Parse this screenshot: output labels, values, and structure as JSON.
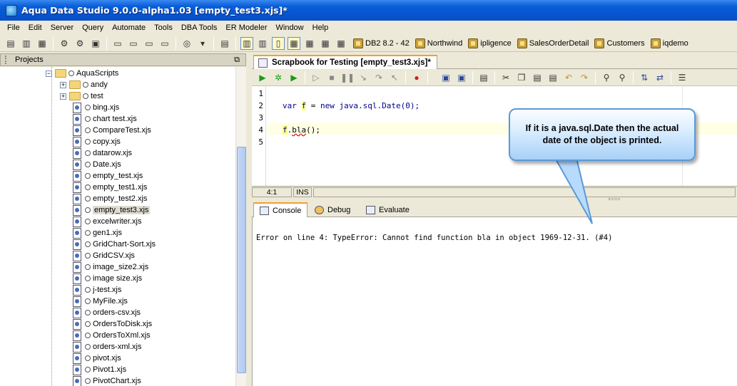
{
  "window": {
    "title": "Aqua Data Studio 9.0.0-alpha1.03 [empty_test3.xjs]*"
  },
  "menu": [
    "File",
    "Edit",
    "Server",
    "Query",
    "Automate",
    "Tools",
    "DBA Tools",
    "ER Modeler",
    "Window",
    "Help"
  ],
  "connections": [
    "DB2 8.2 - 42",
    "Northwind",
    "ipligence",
    "SalesOrderDetail",
    "Customers",
    "iqdemo"
  ],
  "projects_panel": {
    "title": "Projects",
    "restore_glyph": "⧉",
    "tree": {
      "root": "AquaScripts",
      "folders": [
        "andy",
        "test"
      ],
      "files": [
        "bing.xjs",
        "chart test.xjs",
        "CompareTest.xjs",
        "copy.xjs",
        "datarow.xjs",
        "Date.xjs",
        "empty_test.xjs",
        "empty_test1.xjs",
        "empty_test2.xjs",
        "empty_test3.xjs",
        "excelwriter.xjs",
        "gen1.xjs",
        "GridChart-Sort.xjs",
        "GridCSV.xjs",
        "image_size2.xjs",
        "image size.xjs",
        "j-test.xjs",
        "MyFile.xjs",
        "orders-csv.xjs",
        "OrdersToDisk.xjs",
        "OrdersToXml.xjs",
        "orders-xml.xjs",
        "pivot.xjs",
        "Pivot1.xjs",
        "PivotChart.xjs"
      ],
      "selected": "empty_test3.xjs"
    }
  },
  "editor_tab": {
    "label": "Scrapbook for Testing [empty_test3.xjs]*"
  },
  "editor": {
    "line_numbers": [
      "1",
      "2",
      "3",
      "4",
      "5"
    ],
    "code": {
      "line2_kw1": "var",
      "line2_var": "f",
      "line2_eq": " = ",
      "line2_kw2": "new",
      "line2_rest": " java.sql.Date(0);",
      "line4_var": "f",
      "line4_dot": ".",
      "line4_err": "bla",
      "line4_rest": "();"
    }
  },
  "status": {
    "position": "4:1",
    "mode": "INS"
  },
  "bottom_tabs": [
    "Console",
    "Debug",
    "Evaluate"
  ],
  "console": {
    "message": "Error on line 4: TypeError: Cannot find function bla in object 1969-12-31. (#4)"
  },
  "callout": {
    "text": "If it is a java.sql.Date then the actual date of the object is printed."
  }
}
